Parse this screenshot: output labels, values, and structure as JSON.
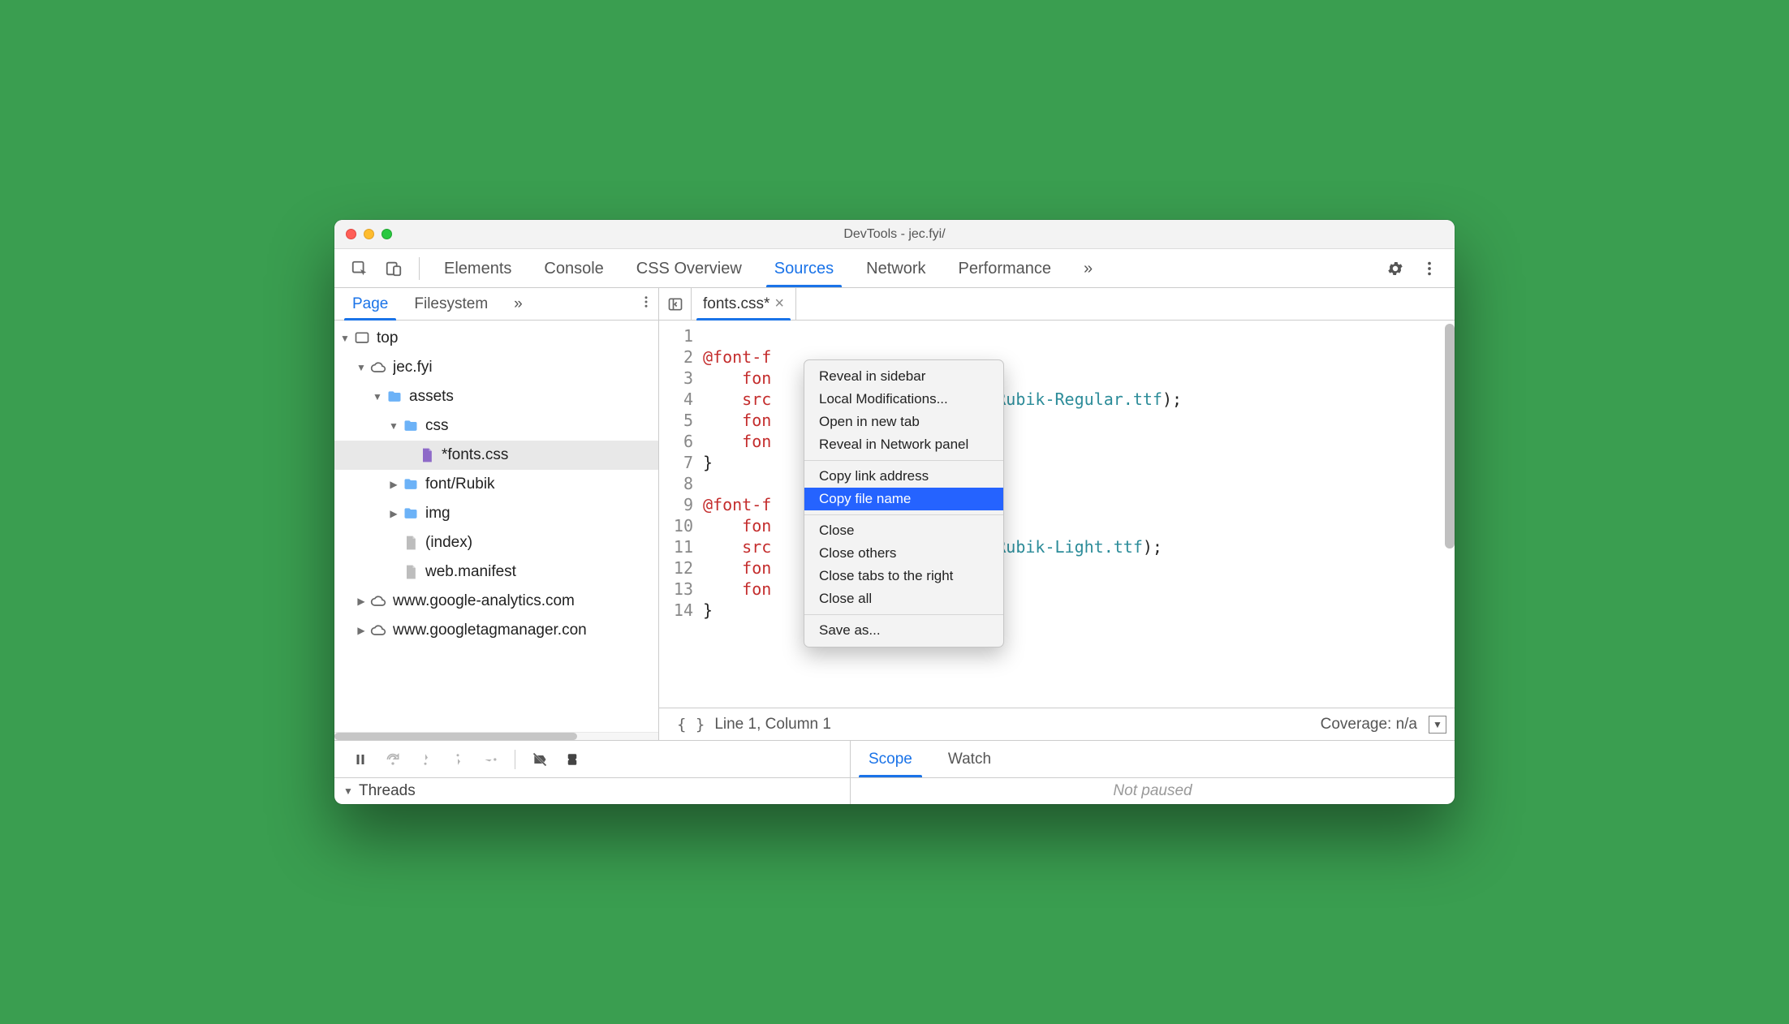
{
  "window": {
    "title": "DevTools - jec.fyi/"
  },
  "main_tabs": {
    "elements": "Elements",
    "console": "Console",
    "css_overview": "CSS Overview",
    "sources": "Sources",
    "network": "Network",
    "performance": "Performance",
    "more": "»"
  },
  "sidebar_tabs": {
    "page": "Page",
    "filesystem": "Filesystem",
    "more": "»"
  },
  "tree": {
    "top": "top",
    "jecfyi": "jec.fyi",
    "assets": "assets",
    "css": "css",
    "fontscss": "*fonts.css",
    "fontrubik": "font/Rubik",
    "img": "img",
    "index": "(index)",
    "manifest": "web.manifest",
    "ga": "www.google-analytics.com",
    "gtm": "www.googletagmanager.con"
  },
  "filetab": {
    "label": "fonts.css*"
  },
  "code": {
    "lines": {
      "l1": "@font-f",
      "l2": "    fon",
      "l3": "    src",
      "l3b": "Rubik/Rubik-Regular.ttf",
      "l3c": ");",
      "l4": "    fon",
      "l5": "    fon",
      "l6": "}",
      "l7": "",
      "l8": "@font-f",
      "l9": "    fon",
      "l10": "    src",
      "l10b": "Rubik/Rubik-Light.ttf",
      "l10c": ");",
      "l11": "    fon",
      "l12": "    fon",
      "l13": "}",
      "l14": ""
    },
    "gutter": [
      "1",
      "2",
      "3",
      "4",
      "5",
      "6",
      "7",
      "8",
      "9",
      "10",
      "11",
      "12",
      "13",
      "14"
    ]
  },
  "status": {
    "linecol": "Line 1, Column 1",
    "coverage": "Coverage: n/a"
  },
  "debug_tabs": {
    "scope": "Scope",
    "watch": "Watch"
  },
  "threads_label": "Threads",
  "not_paused": "Not paused",
  "context_menu": {
    "reveal_sidebar": "Reveal in sidebar",
    "local_mods": "Local Modifications...",
    "open_tab": "Open in new tab",
    "reveal_network": "Reveal in Network panel",
    "copy_link": "Copy link address",
    "copy_filename": "Copy file name",
    "close": "Close",
    "close_others": "Close others",
    "close_right": "Close tabs to the right",
    "close_all": "Close all",
    "save_as": "Save as..."
  }
}
